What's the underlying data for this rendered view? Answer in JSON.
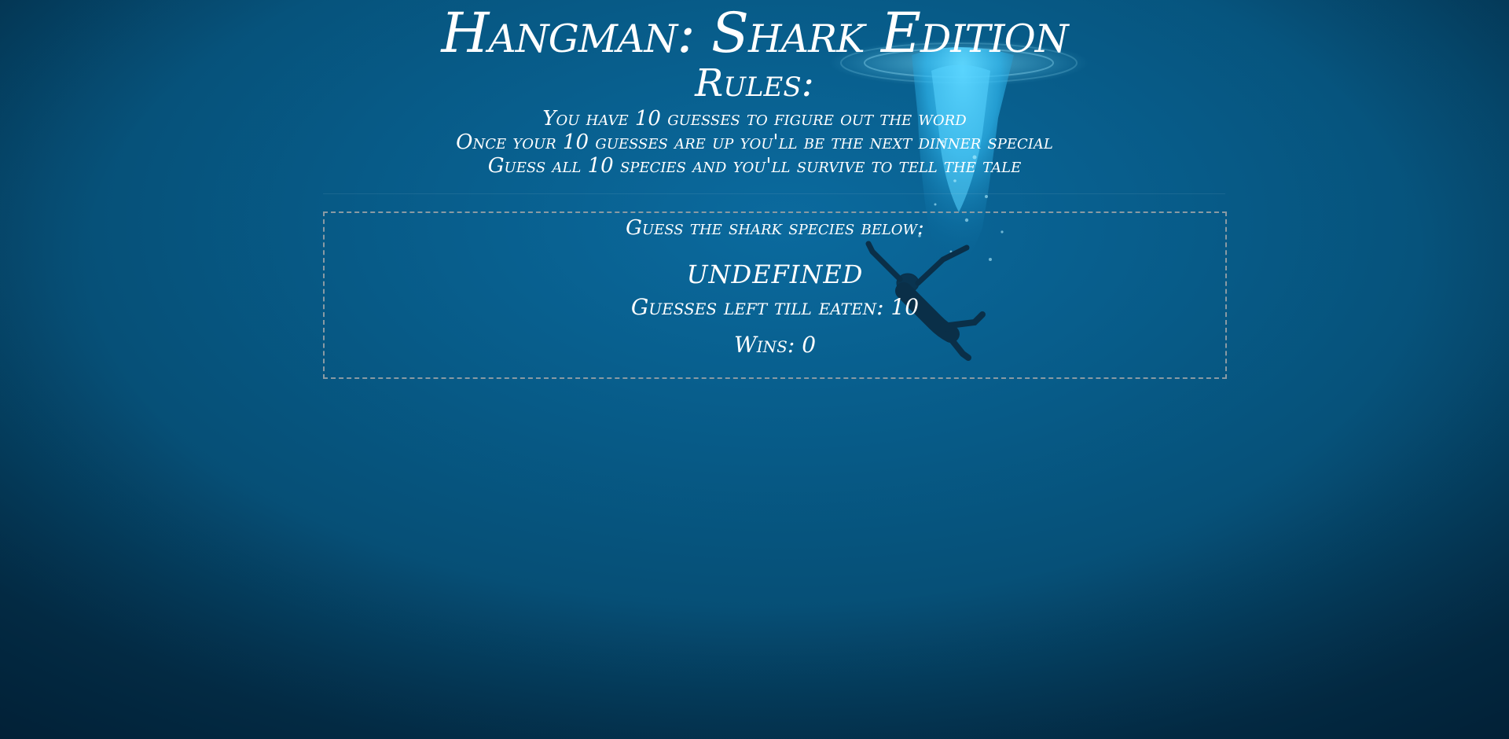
{
  "header": {
    "title": "Hangman: Shark Edition",
    "rules_heading": "Rules:",
    "rules": [
      "You have 10 guesses to figure out the word",
      "Once your 10 guesses are up you'll be the next dinner special",
      "Guess all 10 species and you'll survive to tell the tale"
    ]
  },
  "game": {
    "prompt": "Guess the shark species below:",
    "word": "undefined",
    "guesses_label": "Guesses left till eaten: 10",
    "wins_label": "Wins: 0"
  },
  "colors": {
    "background": "#075b88",
    "text": "#ffffff",
    "splash": "#3fc6f5",
    "border": "#8a9aa3"
  },
  "icons": {
    "scene": "diver-falling-into-water-illustration"
  }
}
